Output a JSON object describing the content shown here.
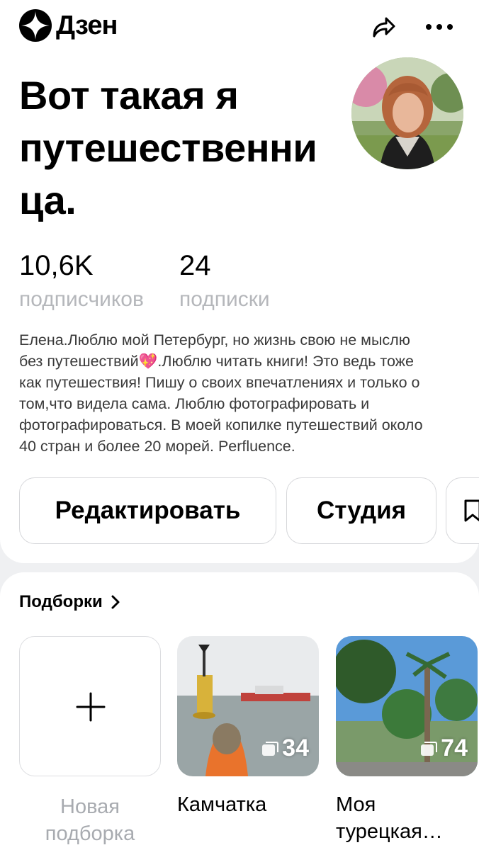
{
  "header": {
    "logo_text": "Дзен",
    "share_icon": "share-icon",
    "more_icon": "more-icon"
  },
  "profile": {
    "title": "Вот такая я путешественни ца.",
    "title_lines": [
      "Вот такая я",
      "путешественни",
      "ца."
    ],
    "stats": {
      "subscribers_value": "10,6K",
      "subscribers_label": "подписчиков",
      "subscriptions_value": "24",
      "subscriptions_label": "подписки"
    },
    "bio_lines": [
      "Елена.Люблю мой Петербург, но жизнь свою не мыслю",
      "без путешествий💖.Люблю читать книги! Это ведь тоже",
      "как путешествия! Пишу о своих впечатлениях и только о",
      "том,что видела сама. Люблю фотографировать и",
      "фотографироваться. В моей копилке путешествий около",
      "40 стран и более 20 морей. Perfluence."
    ]
  },
  "actions": {
    "edit_label": "Редактировать",
    "studio_label": "Студия",
    "bookmark_icon": "bookmark-icon"
  },
  "collections": {
    "section_title": "Подборки",
    "new_label_lines": [
      "Новая",
      "подборка"
    ],
    "items": [
      {
        "title": "Камчатка",
        "count": "34"
      },
      {
        "title_lines": [
          "Моя",
          "турецкая…"
        ],
        "count": "74"
      }
    ]
  },
  "colors": {
    "accent_background": "#eff0f2",
    "muted_text": "#b5b7bb",
    "border": "#d6d7da"
  }
}
